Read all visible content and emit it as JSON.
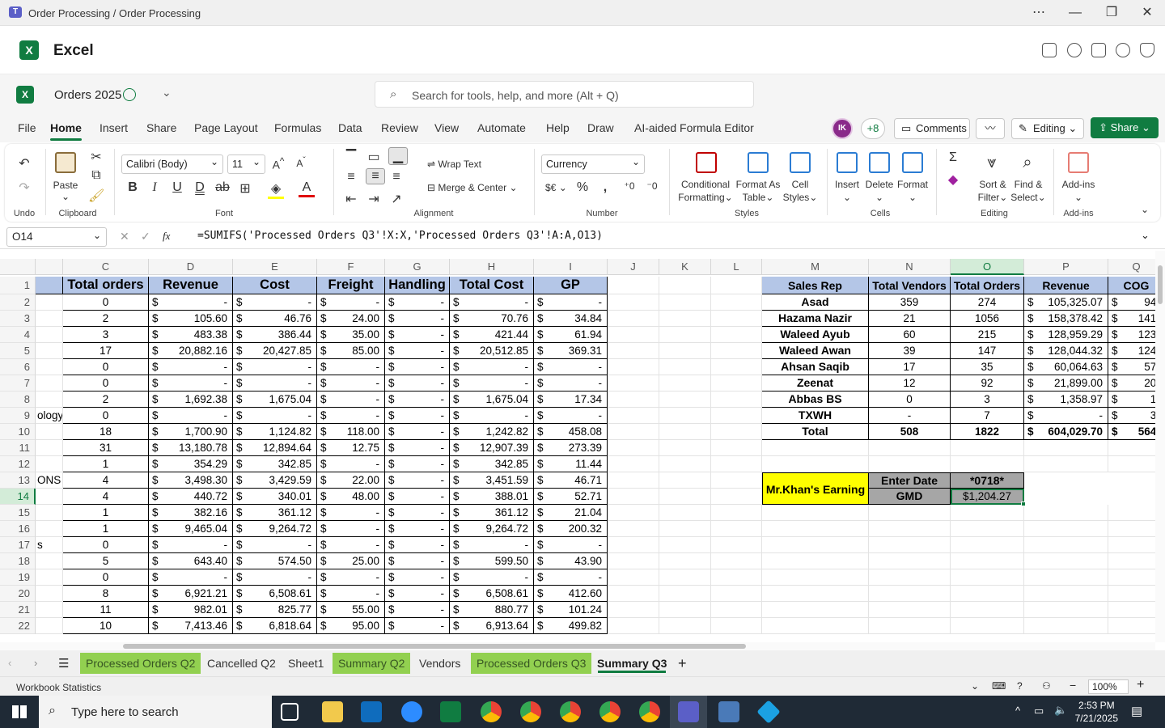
{
  "window": {
    "title": "Order Processing / Order Processing"
  },
  "app": {
    "name": "Excel",
    "doc_name": "Orders 2025",
    "search_placeholder": "Search for tools, help, and more (Alt + Q)"
  },
  "menu": {
    "tabs": [
      "File",
      "Home",
      "Insert",
      "Share",
      "Page Layout",
      "Formulas",
      "Data",
      "Review",
      "View",
      "Automate",
      "Help",
      "Draw",
      "AI-aided Formula Editor"
    ],
    "active": "Home"
  },
  "collab": {
    "avatar": "IK",
    "more": "+8",
    "comments": "Comments",
    "editing": "Editing",
    "share": "Share"
  },
  "ribbon": {
    "undo_group": "Undo",
    "clipboard": {
      "paste": "Paste",
      "group": "Clipboard"
    },
    "font": {
      "name": "Calibri (Body)",
      "size": "11",
      "group": "Font"
    },
    "alignment": {
      "wrap": "Wrap Text",
      "merge": "Merge & Center",
      "group": "Alignment"
    },
    "number": {
      "format": "Currency",
      "currency_symbol": "$€",
      "group": "Number"
    },
    "styles": {
      "cond_fmt_1": "Conditional",
      "cond_fmt_2": "Formatting",
      "fmt_table_1": "Format As",
      "fmt_table_2": "Table",
      "cell_styles_1": "Cell",
      "cell_styles_2": "Styles",
      "group": "Styles"
    },
    "cells": {
      "insert": "Insert",
      "delete": "Delete",
      "format": "Format",
      "group": "Cells"
    },
    "editing": {
      "sort_1": "Sort &",
      "sort_2": "Filter",
      "find_1": "Find &",
      "find_2": "Select",
      "group": "Editing"
    },
    "addins": {
      "label": "Add-ins",
      "group": "Add-ins"
    }
  },
  "formula_bar": {
    "name_box": "O14",
    "fx": "fx",
    "formula": "=SUMIFS('Processed Orders Q3'!X:X,'Processed Orders Q3'!A:A,O13)"
  },
  "columns": [
    "C",
    "D",
    "E",
    "F",
    "G",
    "H",
    "I",
    "J",
    "K",
    "L",
    "M",
    "N",
    "O",
    "P",
    "Q"
  ],
  "rows": [
    "1",
    "2",
    "3",
    "4",
    "5",
    "6",
    "7",
    "8",
    "9",
    "10",
    "11",
    "12",
    "13",
    "14",
    "15",
    "16",
    "17",
    "18",
    "19",
    "20",
    "21",
    "22"
  ],
  "left_table": {
    "headers": [
      "Total orders",
      "Revenue",
      "Cost",
      "Freight",
      "Handling",
      "Total Cost",
      "GP"
    ],
    "rows": [
      [
        "",
        "0",
        "-",
        "-",
        "-",
        "-",
        "-",
        "-"
      ],
      [
        "",
        "2",
        "105.60",
        "46.76",
        "24.00",
        "-",
        "70.76",
        "34.84"
      ],
      [
        "",
        "3",
        "483.38",
        "386.44",
        "35.00",
        "-",
        "421.44",
        "61.94"
      ],
      [
        "",
        "17",
        "20,882.16",
        "20,427.85",
        "85.00",
        "-",
        "20,512.85",
        "369.31"
      ],
      [
        "",
        "0",
        "-",
        "-",
        "-",
        "-",
        "-",
        "-"
      ],
      [
        "",
        "0",
        "-",
        "-",
        "-",
        "-",
        "-",
        "-"
      ],
      [
        "",
        "2",
        "1,692.38",
        "1,675.04",
        "-",
        "-",
        "1,675.04",
        "17.34"
      ],
      [
        "ology",
        "0",
        "-",
        "-",
        "-",
        "-",
        "-",
        "-"
      ],
      [
        "",
        "18",
        "1,700.90",
        "1,124.82",
        "118.00",
        "-",
        "1,242.82",
        "458.08"
      ],
      [
        "",
        "31",
        "13,180.78",
        "12,894.64",
        "12.75",
        "-",
        "12,907.39",
        "273.39"
      ],
      [
        "",
        "1",
        "354.29",
        "342.85",
        "-",
        "-",
        "342.85",
        "11.44"
      ],
      [
        "ONS",
        "4",
        "3,498.30",
        "3,429.59",
        "22.00",
        "-",
        "3,451.59",
        "46.71"
      ],
      [
        "",
        "4",
        "440.72",
        "340.01",
        "48.00",
        "-",
        "388.01",
        "52.71"
      ],
      [
        "",
        "1",
        "382.16",
        "361.12",
        "-",
        "-",
        "361.12",
        "21.04"
      ],
      [
        "",
        "1",
        "9,465.04",
        "9,264.72",
        "-",
        "-",
        "9,264.72",
        "200.32"
      ],
      [
        "s",
        "0",
        "-",
        "-",
        "-",
        "-",
        "-",
        "-"
      ],
      [
        "",
        "5",
        "643.40",
        "574.50",
        "25.00",
        "-",
        "599.50",
        "43.90"
      ],
      [
        "",
        "0",
        "-",
        "-",
        "-",
        "-",
        "-",
        "-"
      ],
      [
        "",
        "8",
        "6,921.21",
        "6,508.61",
        "-",
        "-",
        "6,508.61",
        "412.60"
      ],
      [
        "",
        "11",
        "982.01",
        "825.77",
        "55.00",
        "-",
        "880.77",
        "101.24"
      ],
      [
        "",
        "10",
        "7,413.46",
        "6,818.64",
        "95.00",
        "-",
        "6,913.64",
        "499.82"
      ]
    ]
  },
  "currency_symbol": "$",
  "right_table": {
    "headers": [
      "Sales Rep",
      "Total Vendors",
      "Total Orders",
      "Revenue",
      "COG"
    ],
    "rows": [
      [
        "Asad",
        "359",
        "274",
        "105,325.07",
        "94,"
      ],
      [
        "Hazama Nazir",
        "21",
        "1056",
        "158,378.42",
        "141,"
      ],
      [
        "Waleed Ayub",
        "60",
        "215",
        "128,959.29",
        "123,"
      ],
      [
        "Waleed Awan",
        "39",
        "147",
        "128,044.32",
        "124,"
      ],
      [
        "Ahsan Saqib",
        "17",
        "35",
        "60,064.63",
        "57,"
      ],
      [
        "Zeenat",
        "12",
        "92",
        "21,899.00",
        "20,"
      ],
      [
        "Abbas BS",
        "0",
        "3",
        "1,358.97",
        "1,"
      ],
      [
        "TXWH",
        "-",
        "7",
        "-",
        "3,"
      ],
      [
        "Total",
        "508",
        "1822",
        "604,029.70",
        "564,"
      ]
    ]
  },
  "earning": {
    "label": "Mr.Khan's Earning",
    "enter_date": "Enter Date",
    "date_value": "*0718*",
    "gmd": "GMD",
    "amount": "$1,204.27"
  },
  "sheets": {
    "tabs": [
      "Processed Orders Q2",
      "Cancelled Q2",
      "Sheet1",
      "Summary Q2",
      "Vendors",
      "Processed Orders Q3",
      "Summary Q3"
    ],
    "green": [
      "Processed Orders Q2",
      "Summary Q2",
      "Processed Orders Q3"
    ],
    "active": "Summary Q3"
  },
  "status": {
    "left": "Workbook Statistics",
    "zoom": "100%"
  },
  "taskbar": {
    "search": "Type here to search",
    "time": "2:53 PM",
    "date": "7/21/2025"
  },
  "colors": {
    "excel_green": "#107c41",
    "tab_green": "#92d050",
    "header_blue": "#b4c6e7",
    "yellow": "#ffff00",
    "gray": "#a6a6a6"
  }
}
